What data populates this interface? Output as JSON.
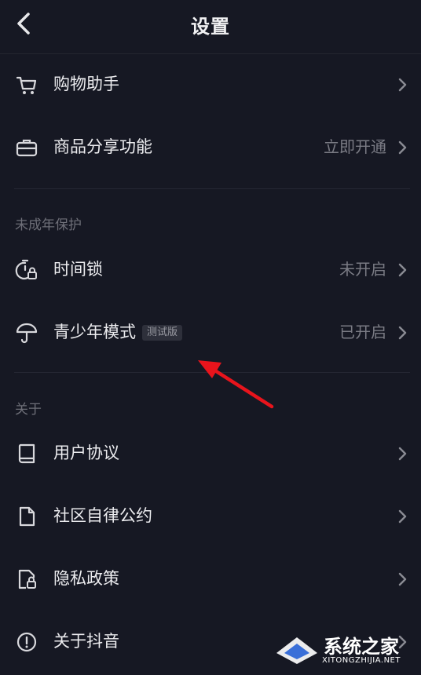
{
  "header": {
    "title": "设置",
    "back_icon": "chevron-left-icon"
  },
  "shopping": {
    "items": [
      {
        "label": "购物助手",
        "value": "",
        "icon": "cart-icon"
      },
      {
        "label": "商品分享功能",
        "value": "立即开通",
        "icon": "briefcase-icon"
      }
    ]
  },
  "minor_section": {
    "title": "未成年保护",
    "items": [
      {
        "label": "时间锁",
        "value": "未开启",
        "icon": "timer-lock-icon"
      },
      {
        "label": "青少年模式",
        "badge": "测试版",
        "value": "已开启",
        "icon": "umbrella-icon"
      }
    ]
  },
  "about_section": {
    "title": "关于",
    "items": [
      {
        "label": "用户协议",
        "icon": "book-icon"
      },
      {
        "label": "社区自律公约",
        "icon": "document-icon"
      },
      {
        "label": "隐私政策",
        "icon": "privacy-lock-icon"
      },
      {
        "label": "关于抖音",
        "icon": "info-icon"
      }
    ]
  },
  "annotation": {
    "arrow_color": "#e8141c"
  },
  "watermark": {
    "text": "系统之家",
    "subtext": "XITONGZHIJIA.NET"
  },
  "colors": {
    "background": "#161823",
    "text": "#ececef",
    "secondary": "#7a7b84"
  }
}
